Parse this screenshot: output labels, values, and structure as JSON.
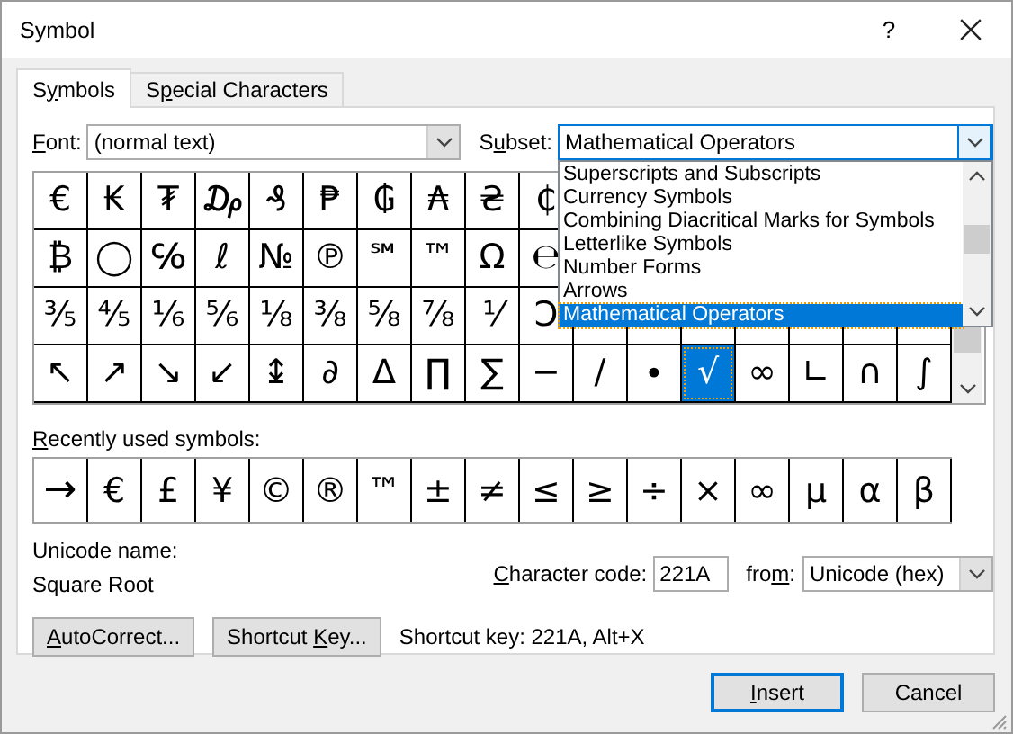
{
  "window": {
    "title": "Symbol",
    "help": "?"
  },
  "tabs": [
    {
      "label": {
        "before": "S",
        "key": "y",
        "after": "mbols"
      },
      "selected": true
    },
    {
      "label": {
        "before": "S",
        "key": "p",
        "after": "ecial Characters"
      },
      "selected": false
    }
  ],
  "font": {
    "label": {
      "key": "F",
      "after": "ont:"
    },
    "value": "(normal text)"
  },
  "subset": {
    "label": {
      "before": "S",
      "key": "u",
      "after": "bset:"
    },
    "value": "Mathematical Operators",
    "expanded": true,
    "options": [
      {
        "label": "Superscripts and Subscripts",
        "selected": false
      },
      {
        "label": "Currency Symbols",
        "selected": false
      },
      {
        "label": "Combining Diacritical Marks for Symbols",
        "selected": false
      },
      {
        "label": "Letterlike Symbols",
        "selected": false
      },
      {
        "label": "Number Forms",
        "selected": false
      },
      {
        "label": "Arrows",
        "selected": false
      },
      {
        "label": "Mathematical Operators",
        "selected": true
      }
    ]
  },
  "symbol_grid": [
    [
      {
        "char": "€",
        "selected": false
      },
      {
        "char": "₭",
        "selected": false
      },
      {
        "char": "₮",
        "selected": false
      },
      {
        "char": "₯",
        "selected": false
      },
      {
        "char": "₰",
        "selected": false
      },
      {
        "char": "₱",
        "selected": false
      },
      {
        "char": "₲",
        "selected": false
      },
      {
        "char": "₳",
        "selected": false
      },
      {
        "char": "₴",
        "selected": false
      },
      {
        "char": "₵",
        "selected": false
      }
    ],
    [
      {
        "char": "₿",
        "selected": false
      },
      {
        "char": "◯",
        "selected": false
      },
      {
        "char": "℅",
        "selected": false
      },
      {
        "char": "ℓ",
        "selected": false
      },
      {
        "char": "№",
        "selected": false
      },
      {
        "char": "℗",
        "selected": false
      },
      {
        "char": "℠",
        "selected": false
      },
      {
        "char": "™",
        "selected": false
      },
      {
        "char": "Ω",
        "selected": false
      },
      {
        "char": "℮",
        "selected": false
      }
    ],
    [
      {
        "char": "⅗",
        "selected": false
      },
      {
        "char": "⅘",
        "selected": false
      },
      {
        "char": "⅙",
        "selected": false
      },
      {
        "char": "⅚",
        "selected": false
      },
      {
        "char": "⅛",
        "selected": false
      },
      {
        "char": "⅜",
        "selected": false
      },
      {
        "char": "⅝",
        "selected": false
      },
      {
        "char": "⅞",
        "selected": false
      },
      {
        "char": "⅟",
        "selected": false
      },
      {
        "char": "Ↄ",
        "selected": false
      }
    ],
    [
      {
        "char": "↖",
        "selected": false
      },
      {
        "char": "↗",
        "selected": false
      },
      {
        "char": "↘",
        "selected": false
      },
      {
        "char": "↙",
        "selected": false
      },
      {
        "char": "↨",
        "selected": false
      },
      {
        "char": "∂",
        "selected": false
      },
      {
        "char": "∆",
        "selected": false
      },
      {
        "char": "∏",
        "selected": false
      },
      {
        "char": "∑",
        "selected": false
      },
      {
        "char": "−",
        "selected": false
      },
      {
        "char": "∕",
        "selected": false
      },
      {
        "char": "∙",
        "selected": false
      },
      {
        "char": "√",
        "selected": true
      },
      {
        "char": "∞",
        "selected": false
      },
      {
        "char": "∟",
        "selected": false
      },
      {
        "char": "∩",
        "selected": false
      },
      {
        "char": "∫",
        "selected": false
      }
    ]
  ],
  "recent": {
    "label": {
      "key": "R",
      "after": "ecently used symbols:"
    },
    "symbols": [
      "→",
      "€",
      "£",
      "¥",
      "©",
      "®",
      "™",
      "±",
      "≠",
      "≤",
      "≥",
      "÷",
      "×",
      "∞",
      "µ",
      "α",
      "β"
    ]
  },
  "unicode_name": {
    "label": "Unicode name:",
    "value": "Square Root"
  },
  "character_code": {
    "label": {
      "key": "C",
      "after": "haracter code:"
    },
    "value": "221A"
  },
  "from": {
    "label": {
      "before": "fro",
      "key": "m",
      "after": ":"
    },
    "value": "Unicode (hex)"
  },
  "buttons": [
    {
      "label": {
        "key": "A",
        "after": "utoCorrect..."
      }
    },
    {
      "label": {
        "before": "Shortcut ",
        "key": "K",
        "after": "ey..."
      }
    }
  ],
  "shortcut_text": "Shortcut key: 221A, Alt+X",
  "footer_buttons": [
    {
      "label": {
        "key": "I",
        "after": "nsert"
      },
      "default": true
    },
    {
      "label": {
        "before": "Cancel"
      },
      "default": false
    }
  ]
}
